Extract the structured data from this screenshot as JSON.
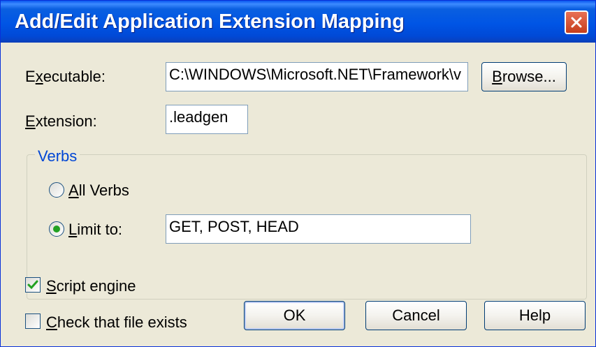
{
  "window": {
    "title": "Add/Edit Application Extension Mapping"
  },
  "executable": {
    "label_prefix": "E",
    "label_accel": "x",
    "label_rest": "ecutable:",
    "value": "C:\\WINDOWS\\Microsoft.NET\\Framework\\v",
    "browse_label_accel": "B",
    "browse_label_rest": "rowse..."
  },
  "extension": {
    "label_accel": "E",
    "label_rest": "xtension:",
    "value": ".leadgen"
  },
  "verbs": {
    "group_title": "Verbs",
    "all_verbs_accel": "A",
    "all_verbs_rest": "ll Verbs",
    "all_verbs_selected": false,
    "limit_to_accel": "L",
    "limit_to_rest": "imit to:",
    "limit_to_selected": true,
    "limit_value": "GET, POST, HEAD"
  },
  "options": {
    "script_engine_accel": "S",
    "script_engine_rest": "cript engine",
    "script_engine_checked": true,
    "check_file_accel": "C",
    "check_file_rest": "heck that file exists",
    "check_file_checked": false
  },
  "buttons": {
    "ok": "OK",
    "cancel": "Cancel",
    "help": "Help"
  },
  "colors": {
    "titlebar": "#0055E5",
    "dialog_bg": "#ECE9D8",
    "groupbox_title": "#0046D5",
    "close_button": "#D7532F",
    "radio_dot": "#21A121",
    "check_mark": "#21A121"
  }
}
